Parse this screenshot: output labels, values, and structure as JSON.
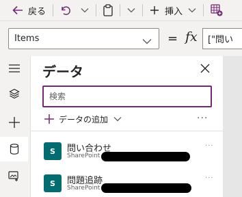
{
  "toolbar": {
    "back_label": "戻る",
    "insert_label": "挿入"
  },
  "formula_bar": {
    "property": "Items",
    "equals": "=",
    "fx": "fx",
    "formula": "[\"問い"
  },
  "panel": {
    "title": "データ",
    "search_placeholder": "検索",
    "add_data_label": "データの追加",
    "more": "···",
    "sources": [
      {
        "name": "問い合わせ",
        "type": "SharePoint",
        "logo": "S"
      },
      {
        "name": "問題追跡",
        "type": "SharePoint",
        "logo": "S"
      }
    ]
  },
  "colors": {
    "accent": "#742774",
    "sharepoint": "#036c70",
    "background": "#f3f2f1"
  },
  "icons": [
    "back-arrow-icon",
    "undo-icon",
    "chevron-down-icon",
    "paste-icon",
    "plus-icon",
    "add-table-icon",
    "hamburger-icon",
    "layers-icon",
    "database-icon",
    "media-icon",
    "close-icon",
    "more-icon",
    "sharepoint-icon"
  ]
}
